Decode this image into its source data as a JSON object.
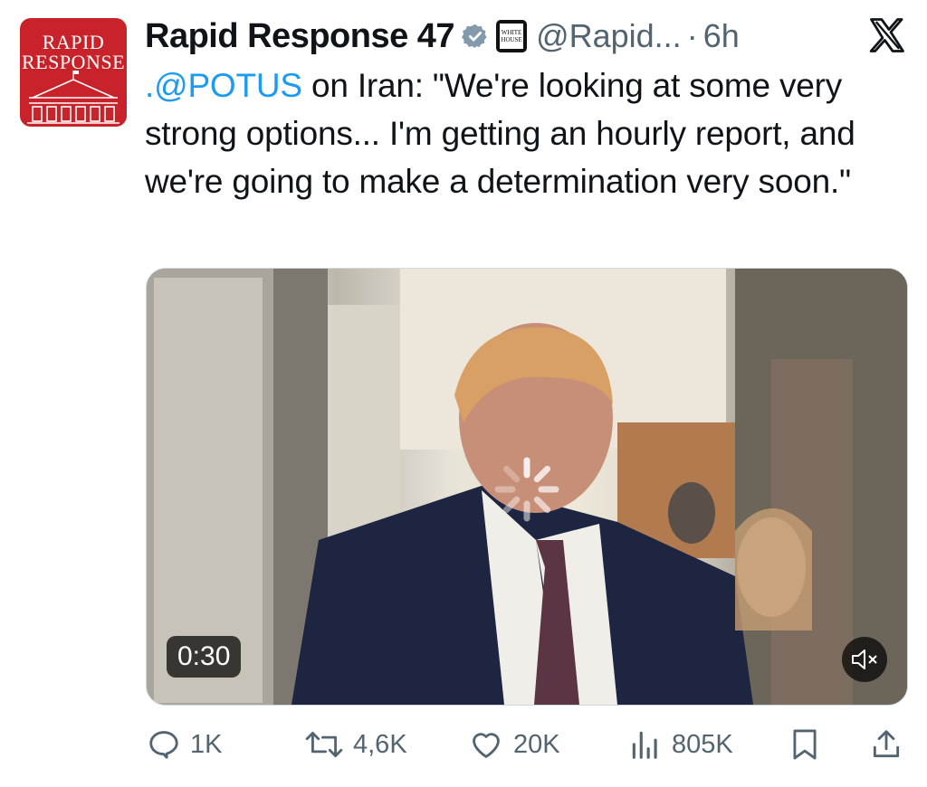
{
  "author": {
    "avatar_line1": "RAPID",
    "avatar_line2": "RESPONSE",
    "name": "Rapid Response 47",
    "affiliate_badge_line1": "WHITE",
    "affiliate_badge_line2": "HOUSE",
    "handle": "@Rapid...",
    "separator": "·",
    "time": "6h"
  },
  "tweet": {
    "mention": ".@POTUS",
    "body": " on Iran: \"We're looking at some very strong options... I'm getting an hourly report, and we're going to make a determination very soon.\""
  },
  "media": {
    "duration": "0:30",
    "muted": true,
    "loading": true
  },
  "actions": {
    "replies": "1K",
    "reposts": "4,6K",
    "likes": "20K",
    "views": "805K"
  },
  "colors": {
    "link": "#1d9bf0",
    "muted_text": "#536471",
    "verified": "#829aab",
    "avatar_bg": "#c8232b"
  },
  "icons": [
    "verified-badge-icon",
    "x-logo-icon",
    "reply-icon",
    "repost-icon",
    "like-icon",
    "views-icon",
    "bookmark-icon",
    "share-icon",
    "mute-icon",
    "loading-spinner-icon"
  ]
}
